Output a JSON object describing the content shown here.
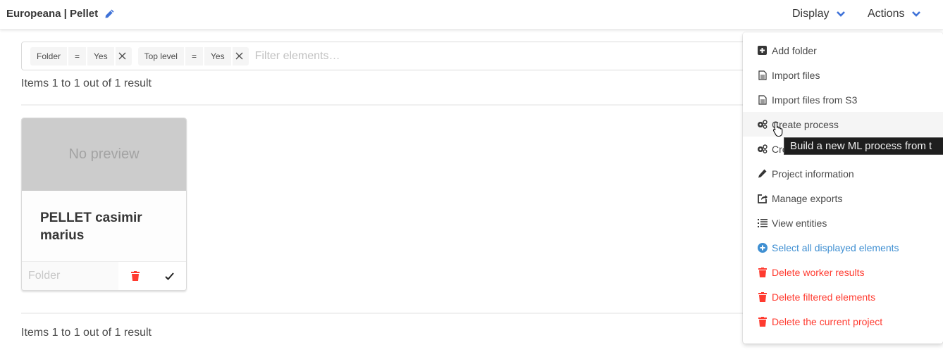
{
  "navbar": {
    "title": "Europeana | Pellet",
    "title_icon": "pencil-icon",
    "display_label": "Display",
    "actions_label": "Actions"
  },
  "filters": {
    "tags": [
      {
        "field": "Folder",
        "operator": "=",
        "value": "Yes"
      },
      {
        "field": "Top level",
        "operator": "=",
        "value": "Yes"
      }
    ],
    "placeholder": "Filter elements…"
  },
  "pagination": {
    "top_text": "Items 1 to 1 out of 1 result",
    "bottom_text": "Items 1 to 1 out of 1 result"
  },
  "elements": [
    {
      "preview_text": "No preview",
      "name": "PELLET casimir marius",
      "type": "Folder",
      "delete_icon": "trash-icon",
      "select_icon": "check-icon"
    }
  ],
  "actions_menu": {
    "items": [
      {
        "label": "Add folder",
        "icon": "plus-square-icon",
        "style": "default"
      },
      {
        "label": "Import files",
        "icon": "file-icon",
        "style": "default"
      },
      {
        "label": "Import files from S3",
        "icon": "file-icon",
        "style": "default"
      },
      {
        "label": "Create process",
        "icon": "cogs-icon",
        "style": "hover"
      },
      {
        "label": "Create training process",
        "icon": "cogs-icon",
        "style": "default"
      },
      {
        "label": "Project information",
        "icon": "pencil-icon",
        "style": "default"
      },
      {
        "label": "Manage exports",
        "icon": "export-icon",
        "style": "default"
      },
      {
        "label": "View entities",
        "icon": "list-icon",
        "style": "default"
      },
      {
        "label": "Select all displayed elements",
        "icon": "plus-circle-icon",
        "style": "blue"
      },
      {
        "label": "Delete worker results",
        "icon": "trash-icon",
        "style": "red"
      },
      {
        "label": "Delete filtered elements",
        "icon": "trash-icon",
        "style": "red"
      },
      {
        "label": "Delete the current project",
        "icon": "trash-icon",
        "style": "red"
      }
    ]
  },
  "tooltip": {
    "text": "Build a new ML process from t"
  },
  "colors": {
    "accent": "#3f8fd2",
    "danger": "#ff3b30",
    "text": "#363636"
  }
}
